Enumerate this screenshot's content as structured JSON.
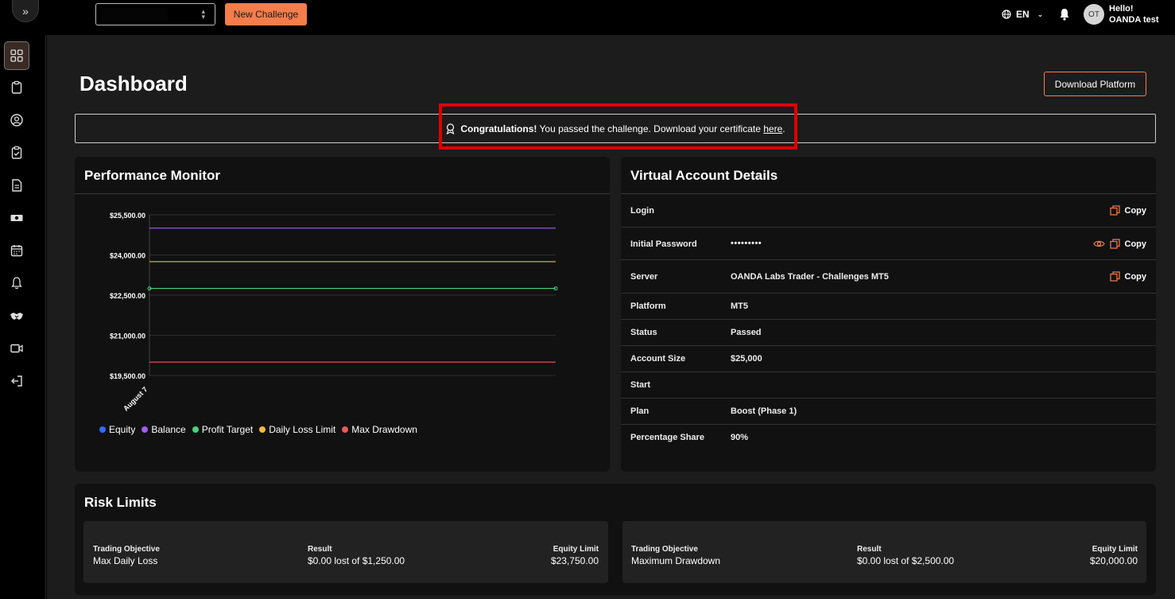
{
  "topbar": {
    "expand_glyph": "»",
    "new_challenge_label": "New Challenge",
    "language": "EN",
    "avatar_initials": "OT",
    "greeting_line1": "Hello!",
    "greeting_line2": "OANDA test"
  },
  "sidebar": {
    "items": [
      {
        "icon": "dashboard-grid-icon"
      },
      {
        "icon": "clipboard-icon"
      },
      {
        "icon": "user-circle-icon"
      },
      {
        "icon": "clipboard-check-icon"
      },
      {
        "icon": "document-icon"
      },
      {
        "icon": "cash-icon"
      },
      {
        "icon": "calendar-icon"
      },
      {
        "icon": "bell-icon"
      },
      {
        "icon": "handshake-icon"
      },
      {
        "icon": "video-icon"
      },
      {
        "icon": "logout-icon"
      }
    ]
  },
  "main": {
    "title": "Dashboard",
    "download_platform_label": "Download Platform",
    "banner": {
      "bold": "Congratulations!",
      "text": " You passed the challenge. Download your certificate ",
      "link": "here",
      "end": "."
    }
  },
  "performance": {
    "title": "Performance Monitor",
    "legend": [
      {
        "name": "Equity",
        "color": "#2f6df6"
      },
      {
        "name": "Balance",
        "color": "#a25cf0"
      },
      {
        "name": "Profit Target",
        "color": "#4cd07d"
      },
      {
        "name": "Daily Loss Limit",
        "color": "#f4b740"
      },
      {
        "name": "Max Drawdown",
        "color": "#e85a5a"
      }
    ]
  },
  "chart_data": {
    "type": "line",
    "x": [
      "August 7"
    ],
    "y_ticks": [
      "$25,500.00",
      "$24,000.00",
      "$22,500.00",
      "$21,000.00",
      "$19,500.00"
    ],
    "ylim": [
      19500,
      25500
    ],
    "series": [
      {
        "name": "Balance",
        "color": "#a25cf0",
        "values": [
          25000
        ]
      },
      {
        "name": "Daily Loss Limit",
        "color": "#f4b740",
        "values": [
          23750
        ]
      },
      {
        "name": "Profit Target",
        "color": "#4cd07d",
        "values": [
          22750
        ]
      },
      {
        "name": "Max Drawdown",
        "color": "#e85a5a",
        "values": [
          20000
        ]
      }
    ]
  },
  "vad": {
    "title": "Virtual Account Details",
    "copy_label": "Copy",
    "rows": [
      {
        "key": "Login",
        "value": ""
      },
      {
        "key": "Initial Password",
        "value": "•••••••••"
      },
      {
        "key": "Server",
        "value": "OANDA Labs Trader - Challenges MT5"
      },
      {
        "key": "Platform",
        "value": "MT5"
      },
      {
        "key": "Status",
        "value": "Passed"
      },
      {
        "key": "Account Size",
        "value": "$25,000"
      },
      {
        "key": "Start",
        "value": ""
      },
      {
        "key": "Plan",
        "value": "Boost (Phase 1)"
      },
      {
        "key": "Percentage Share",
        "value": "90%"
      }
    ]
  },
  "risk": {
    "title": "Risk Limits",
    "boxes": [
      {
        "objective_label": "Trading Objective",
        "objective": "Max Daily Loss",
        "result_label": "Result",
        "result": "$0.00 lost of $1,250.00",
        "limit_label": "Equity Limit",
        "limit": "$23,750.00"
      },
      {
        "objective_label": "Trading Objective",
        "objective": "Maximum Drawdown",
        "result_label": "Result",
        "result": "$0.00 lost of $2,500.00",
        "limit_label": "Equity Limit",
        "limit": "$20,000.00"
      }
    ]
  },
  "colors": {
    "accent": "#f47d4b",
    "highlight": "#e00000"
  }
}
